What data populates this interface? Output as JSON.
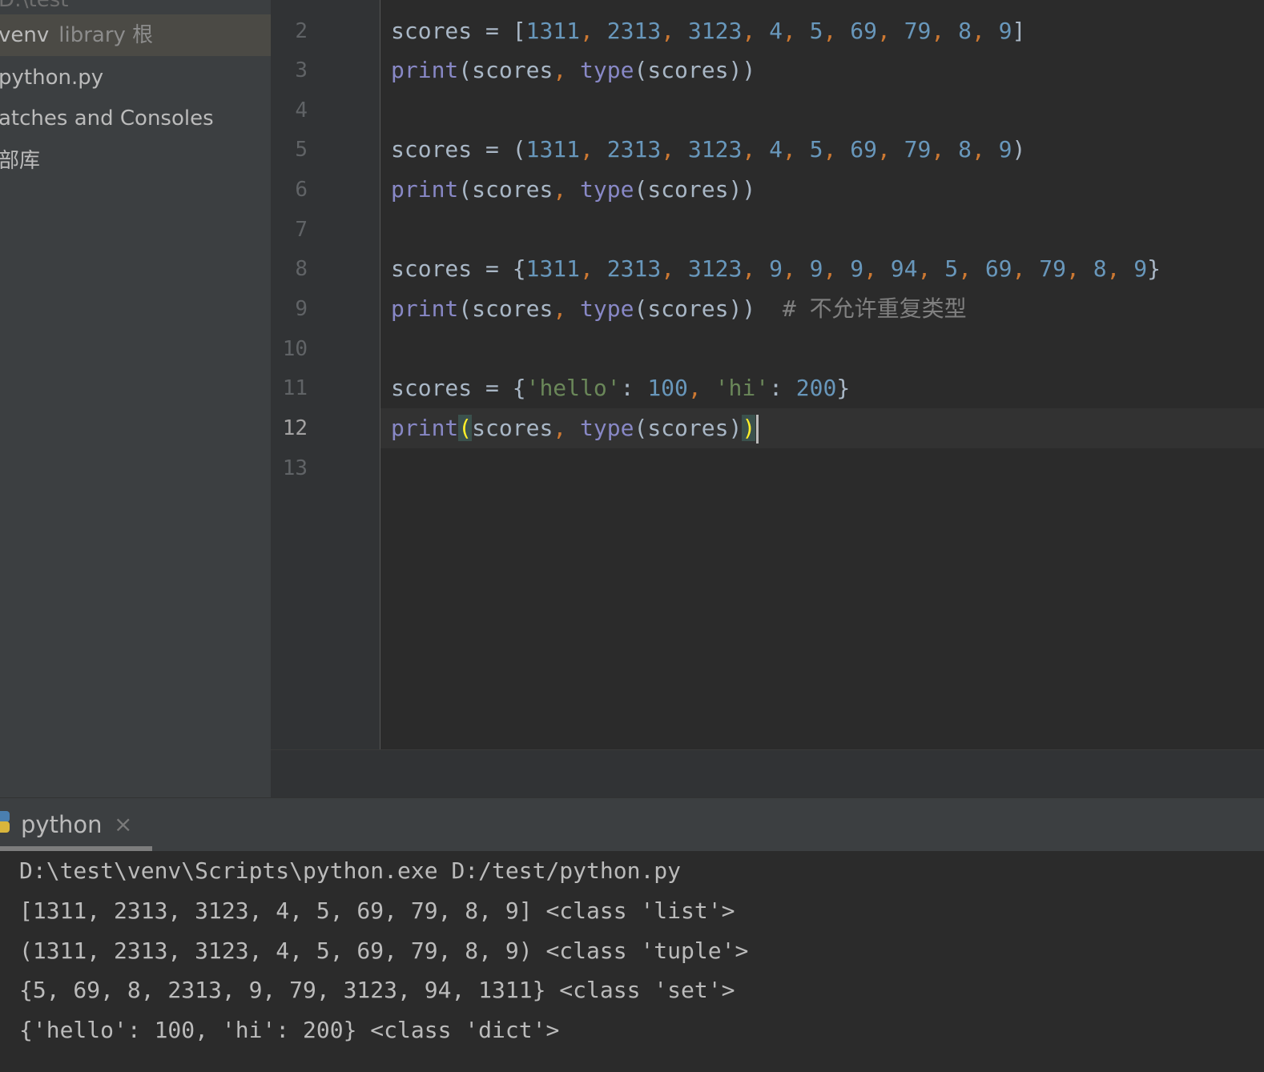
{
  "sidebar": {
    "header": "D:\\test",
    "items": [
      {
        "label": "venv",
        "sub": "library 根"
      },
      {
        "label": "python.py"
      },
      {
        "label": "atches and Consoles"
      },
      {
        "label": "部库"
      }
    ]
  },
  "editor": {
    "line_numbers": [
      "2",
      "3",
      "4",
      "5",
      "6",
      "7",
      "8",
      "9",
      "10",
      "11",
      "12",
      "13"
    ],
    "current_line": "12",
    "code": {
      "l2": {
        "var": "scores",
        "eq": " = ",
        "open": "[",
        "close": "]",
        "nums": [
          "1311",
          "2313",
          "3123",
          "4",
          "5",
          "69",
          "79",
          "8",
          "9"
        ]
      },
      "l3": {
        "fn": "print",
        "arg": "scores",
        "fn2": "type"
      },
      "l5": {
        "var": "scores",
        "eq": " = ",
        "open": "(",
        "close": ")",
        "nums": [
          "1311",
          "2313",
          "3123",
          "4",
          "5",
          "69",
          "79",
          "8",
          "9"
        ]
      },
      "l6": {
        "fn": "print",
        "arg": "scores",
        "fn2": "type"
      },
      "l8": {
        "var": "scores",
        "eq": " = ",
        "open": "{",
        "close": "}",
        "nums": [
          "1311",
          "2313",
          "3123",
          "9",
          "9",
          "9",
          "94",
          "5",
          "69",
          "79",
          "8",
          "9"
        ]
      },
      "l9": {
        "fn": "print",
        "arg": "scores",
        "fn2": "type",
        "comment": "# 不允许重复类型"
      },
      "l11": {
        "var": "scores",
        "eq": " = ",
        "key1": "'hello'",
        "val1": "100",
        "key2": "'hi'",
        "val2": "200"
      },
      "l12": {
        "fn": "print",
        "arg": "scores",
        "fn2": "type"
      }
    }
  },
  "run": {
    "tab_label": "python",
    "close_glyph": "×",
    "output": [
      "D:\\test\\venv\\Scripts\\python.exe D:/test/python.py",
      "[1311, 2313, 3123, 4, 5, 69, 79, 8, 9] <class 'list'>",
      "(1311, 2313, 3123, 4, 5, 69, 79, 8, 9) <class 'tuple'>",
      "{5, 69, 8, 2313, 9, 79, 3123, 94, 1311} <class 'set'>",
      "{'hello': 100, 'hi': 200} <class 'dict'>"
    ]
  },
  "colors": {
    "background": "#2b2b2b",
    "sidebar": "#3c3f41",
    "number": "#6897bb",
    "string": "#6a8759",
    "builtin": "#8888c6",
    "comma": "#cc7832",
    "comment": "#808080",
    "brace_match": "#ffef28"
  }
}
